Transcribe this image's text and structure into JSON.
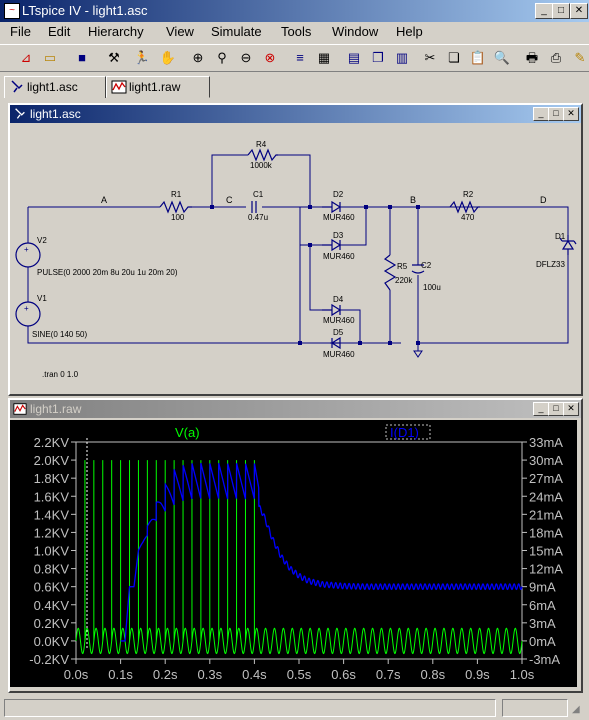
{
  "window": {
    "title": "LTspice IV - light1.asc"
  },
  "menu": [
    "File",
    "Edit",
    "Hierarchy",
    "View",
    "Simulate",
    "Tools",
    "Window",
    "Help"
  ],
  "toolbar_icons": [
    "new-schematic-icon",
    "open-icon",
    "save-icon",
    "control-panel-icon",
    "run-icon",
    "halt-icon",
    "zoom-in-icon",
    "zoom-pan-icon",
    "zoom-out-icon",
    "zoom-full-icon",
    "autorange-icon",
    "grid-icon",
    "tile-horizontal-icon",
    "cascade-icon",
    "tile-vertical-icon",
    "cut-icon",
    "copy-icon",
    "paste-icon",
    "find-icon",
    "print-setup-icon",
    "print-icon",
    "pencil-icon"
  ],
  "tabs": [
    {
      "label": "light1.asc"
    },
    {
      "label": "light1.raw"
    }
  ],
  "schematic": {
    "title": "light1.asc",
    "nodes": {
      "a": "A",
      "c": "C",
      "b": "B",
      "d": "D"
    },
    "components": {
      "r4": {
        "name": "R4",
        "value": "1000k"
      },
      "r1": {
        "name": "R1",
        "value": "100"
      },
      "c1": {
        "name": "C1",
        "value": "0.47u"
      },
      "d2": {
        "name": "D2",
        "value": "MUR460"
      },
      "d3": {
        "name": "D3",
        "value": "MUR460"
      },
      "d4": {
        "name": "D4",
        "value": "MUR460"
      },
      "d5": {
        "name": "D5",
        "value": "MUR460"
      },
      "r2": {
        "name": "R2",
        "value": "470"
      },
      "r5": {
        "name": "R5",
        "value": "220k"
      },
      "c2": {
        "name": "C2",
        "value": "100u"
      },
      "d1": {
        "name": "D1",
        "value": "DFLZ33"
      },
      "v2": {
        "name": "V2",
        "value": "PULSE(0 2000 20m 8u 20u 1u 20m 20)"
      },
      "v1": {
        "name": "V1",
        "value": "SINE(0 140 50)"
      }
    },
    "directive": ".tran 0 1.0"
  },
  "waveform": {
    "title": "light1.raw",
    "trace1_label": "V(a)",
    "trace2_label": "I(D1)",
    "trace1_color": "#00ff00",
    "trace2_color": "#0000ff"
  },
  "chart_data": {
    "type": "line",
    "title": "",
    "xlabel": "",
    "ylabel": "",
    "xlim": [
      0,
      1.0
    ],
    "ylim": [
      -0.2,
      2.2
    ],
    "y2lim": [
      -3,
      33
    ],
    "x_ticks": [
      "0.0s",
      "0.1s",
      "0.2s",
      "0.3s",
      "0.4s",
      "0.5s",
      "0.6s",
      "0.7s",
      "0.8s",
      "0.9s",
      "1.0s"
    ],
    "y_ticks": [
      "-0.2KV",
      "0.0KV",
      "0.2KV",
      "0.4KV",
      "0.6KV",
      "0.8KV",
      "1.0KV",
      "1.2KV",
      "1.4KV",
      "1.6KV",
      "1.8KV",
      "2.0KV",
      "2.2KV"
    ],
    "y2_ticks": [
      "-3mA",
      "0mA",
      "3mA",
      "6mA",
      "9mA",
      "12mA",
      "15mA",
      "18mA",
      "21mA",
      "24mA",
      "27mA",
      "30mA",
      "33mA"
    ],
    "series": [
      {
        "name": "V(a)",
        "axis": "left",
        "pulse_amplitude_kv": 2.0,
        "pulse_period_s": 0.02,
        "pulse_start_s": 0.02,
        "pulse_end_s": 0.4,
        "sine_amplitude_kv": 0.14,
        "sine_freq_hz": 50
      },
      {
        "name": "I(D1)",
        "axis": "right",
        "x": [
          0.1,
          0.11,
          0.12,
          0.13,
          0.14,
          0.15,
          0.17,
          0.19,
          0.21,
          0.23,
          0.25,
          0.27,
          0.29,
          0.31,
          0.33,
          0.35,
          0.37,
          0.39,
          0.4,
          0.42,
          0.44,
          0.46,
          0.48,
          0.5,
          0.52,
          0.55,
          0.6,
          0.65,
          0.7,
          1.0
        ],
        "values": [
          0.0,
          0.0,
          9.0,
          9.0,
          15.0,
          16.0,
          19.0,
          21.0,
          22.0,
          23.0,
          23.5,
          23.5,
          23.5,
          23.5,
          23.5,
          23.5,
          23.5,
          23.5,
          23.5,
          21.0,
          17.0,
          14.0,
          12.0,
          10.8,
          10.0,
          9.4,
          9.1,
          9.0,
          9.0,
          9.0
        ]
      }
    ]
  }
}
